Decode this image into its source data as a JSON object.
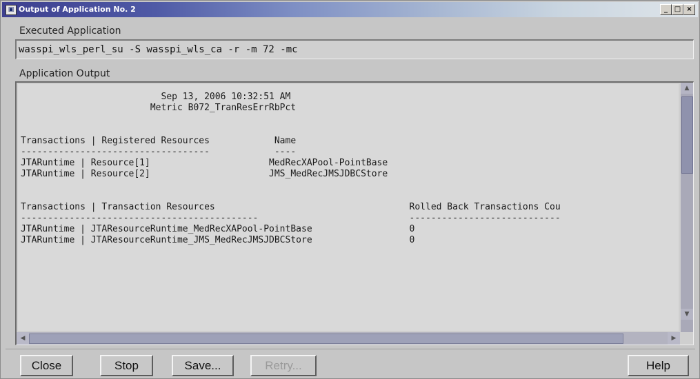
{
  "window": {
    "title": "Output of Application No. 2",
    "icon": "app-icon",
    "controls": [
      "_",
      "□",
      "×"
    ]
  },
  "executed": {
    "label": "Executed Application",
    "command": "wasspi_wls_perl_su -S wasspi_wls_ca -r -m 72 -mc"
  },
  "output": {
    "label": "Application Output",
    "lines": [
      "                          Sep 13, 2006 10:32:51 AM",
      "                        Metric B072_TranResErrRbPct",
      "",
      "",
      "Transactions | Registered Resources            Name",
      "-----------------------------------            ----",
      "JTARuntime | Resource[1]                      MedRecXAPool-PointBase",
      "JTARuntime | Resource[2]                      JMS_MedRecJMSJDBCStore",
      "",
      "",
      "Transactions | Transaction Resources                                    Rolled Back Transactions Cou",
      "--------------------------------------------                            ----------------------------",
      "JTARuntime | JTAResourceRuntime_MedRecXAPool-PointBase                  0",
      "JTARuntime | JTAResourceRuntime_JMS_MedRecJMSJDBCStore                  0"
    ]
  },
  "buttons": {
    "close": "Close",
    "stop": "Stop",
    "save": "Save...",
    "retry": "Retry...",
    "help": "Help"
  }
}
